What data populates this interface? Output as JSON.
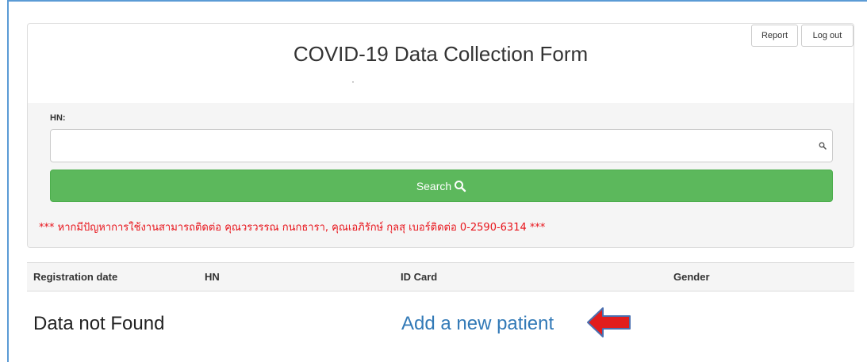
{
  "header": {
    "title": "COVID-19 Data Collection Form",
    "report_label": "Report",
    "logout_label": "Log out"
  },
  "search": {
    "hn_label": "HN:",
    "hn_value": "",
    "button_label": "Search",
    "icon": "search-icon"
  },
  "notice": "*** หากมีปัญหาการใช้งานสามารถติดต่อ คุณวรวรรณ กนกธารา, คุณเอภิรักษ์ กุลสุ เบอร์ติดต่อ 0-2590-6314 ***",
  "table": {
    "columns": [
      "Registration date",
      "HN",
      "ID Card",
      "Gender"
    ]
  },
  "results": {
    "empty_message": "Data not Found",
    "add_link": "Add a new patient"
  },
  "colors": {
    "search_button": "#5cb85c",
    "notice_text": "#e8141b",
    "link": "#337ab7",
    "arrow": "#e11d1d",
    "frame": "#5b9bd5"
  }
}
